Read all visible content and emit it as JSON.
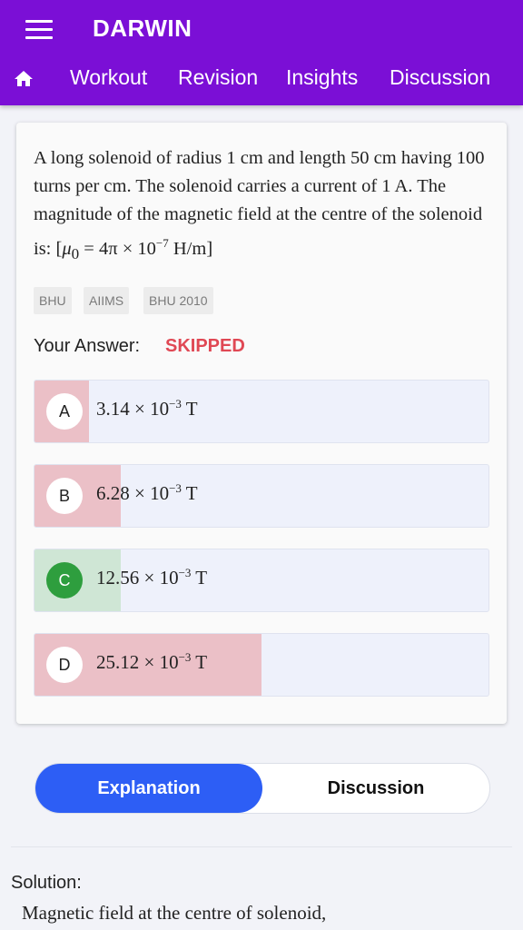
{
  "app": {
    "title": "DARWIN",
    "nav": [
      "Workout",
      "Revision",
      "Insights",
      "Discussion"
    ]
  },
  "question": {
    "text_intro": "A long solenoid of radius 1 cm and length 50 cm having 100 turns per cm. The solenoid carries a current of 1 A. The magnitude of the magnetic field at the centre of the solenoid is: [",
    "mu": "μ",
    "mu_sub": "0",
    "equals": " = 4π × 10",
    "exp": "−7",
    "unit": " H/m]",
    "tags": [
      "BHU",
      "AIIMS",
      "BHU 2010"
    ]
  },
  "answer": {
    "label": "Your Answer:",
    "value": "SKIPPED"
  },
  "options": [
    {
      "letter": "A",
      "mantissa": "3.14 × 10",
      "exp": "−3",
      "unit": " T",
      "share": 0.12,
      "status": "wrong"
    },
    {
      "letter": "B",
      "mantissa": "6.28 × 10",
      "exp": "−3",
      "unit": " T",
      "share": 0.19,
      "status": "wrong"
    },
    {
      "letter": "C",
      "mantissa": "12.56 × 10",
      "exp": "−3",
      "unit": " T",
      "share": 0.19,
      "status": "correct"
    },
    {
      "letter": "D",
      "mantissa": "25.12 × 10",
      "exp": "−3",
      "unit": " T",
      "share": 0.5,
      "status": "wrong"
    }
  ],
  "colors": {
    "header": "#7b0fd6",
    "wrong_fill": "#ebc0c7",
    "correct_fill": "#cfe6d5",
    "correct_badge": "#2e9e3e",
    "skipped": "#e04854",
    "toggle_active": "#2d5ef5"
  },
  "tabs": {
    "explanation": "Explanation",
    "discussion": "Discussion"
  },
  "solution": {
    "heading": "Solution:",
    "text": "Magnetic field at the centre of solenoid,"
  },
  "icons": {
    "menu": "hamburger-menu-icon",
    "home": "home-icon"
  }
}
